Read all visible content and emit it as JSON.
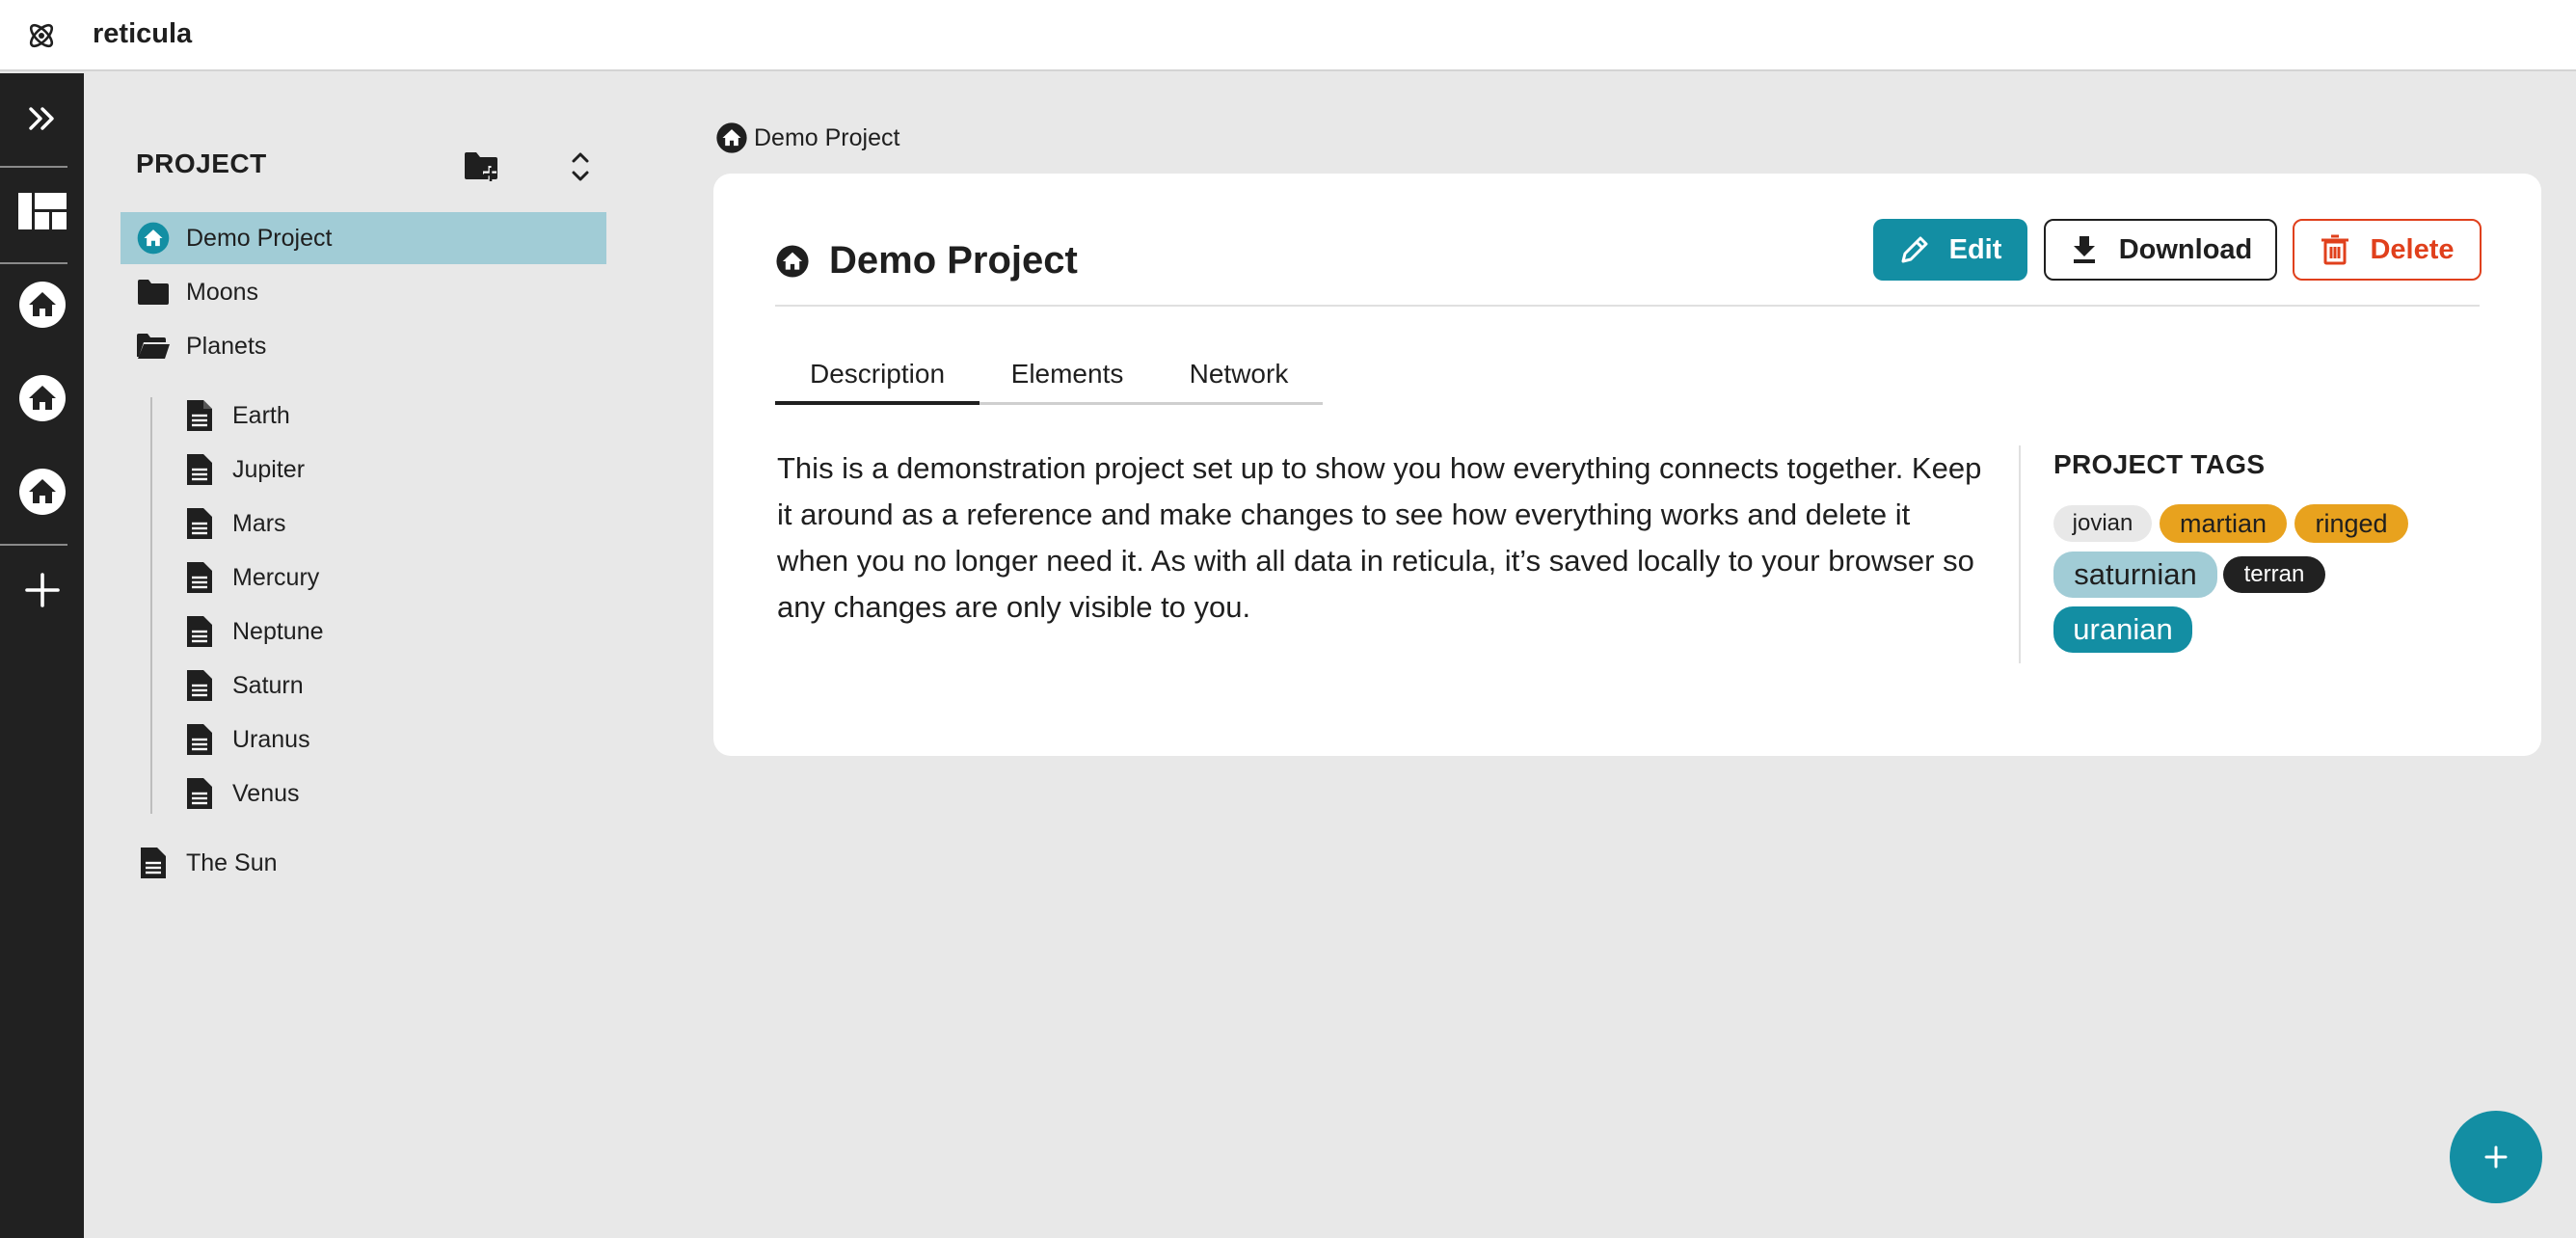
{
  "app": {
    "title": "reticula"
  },
  "rail": {
    "icons": [
      "expand-icon",
      "dashboard-icon",
      "home-icon",
      "home-icon",
      "home-icon",
      "plus-icon"
    ]
  },
  "sidebar": {
    "heading": "PROJECT",
    "items": [
      {
        "label": "Demo Project",
        "icon": "home-icon",
        "selected": true
      },
      {
        "label": "Moons",
        "icon": "folder-icon"
      },
      {
        "label": "Planets",
        "icon": "folder-open-icon"
      },
      {
        "label": "Earth",
        "icon": "document-icon"
      },
      {
        "label": "Jupiter",
        "icon": "document-icon"
      },
      {
        "label": "Mars",
        "icon": "document-icon"
      },
      {
        "label": "Mercury",
        "icon": "document-icon"
      },
      {
        "label": "Neptune",
        "icon": "document-icon"
      },
      {
        "label": "Saturn",
        "icon": "document-icon"
      },
      {
        "label": "Uranus",
        "icon": "document-icon"
      },
      {
        "label": "Venus",
        "icon": "document-icon"
      },
      {
        "label": "The Sun",
        "icon": "document-icon"
      }
    ]
  },
  "breadcrumb": {
    "label": "Demo Project"
  },
  "main": {
    "title": "Demo Project",
    "buttons": {
      "edit": "Edit",
      "download": "Download",
      "delete": "Delete"
    },
    "tabs": [
      {
        "label": "Description",
        "active": true
      },
      {
        "label": "Elements",
        "active": false
      },
      {
        "label": "Network",
        "active": false
      }
    ],
    "description": "This is a demonstration project set up to show you how everything connects together. Keep it around as a reference and make changes to see how everything works and delete it when you no longer need it. As with all data in reticula, it’s saved locally to your browser so any changes are only visible to you.",
    "tags_heading": "PROJECT TAGS",
    "tags": [
      {
        "label": "jovian",
        "bg": "#e8e8e8",
        "fg": "#1f1f1f"
      },
      {
        "label": "martian",
        "bg": "#e8a21e",
        "fg": "#1f1f1f"
      },
      {
        "label": "ringed",
        "bg": "#e8a21e",
        "fg": "#1f1f1f"
      },
      {
        "label": "saturnian",
        "bg": "#a1ccd6",
        "fg": "#1f1f1f"
      },
      {
        "label": "terran",
        "bg": "#212121",
        "fg": "#ffffff"
      },
      {
        "label": "uranian",
        "bg": "#138ea3",
        "fg": "#ffffff"
      }
    ]
  },
  "colors": {
    "accent": "#138ea3",
    "danger": "#e0401c",
    "rail": "#212121",
    "selected": "#a1ccd6"
  }
}
